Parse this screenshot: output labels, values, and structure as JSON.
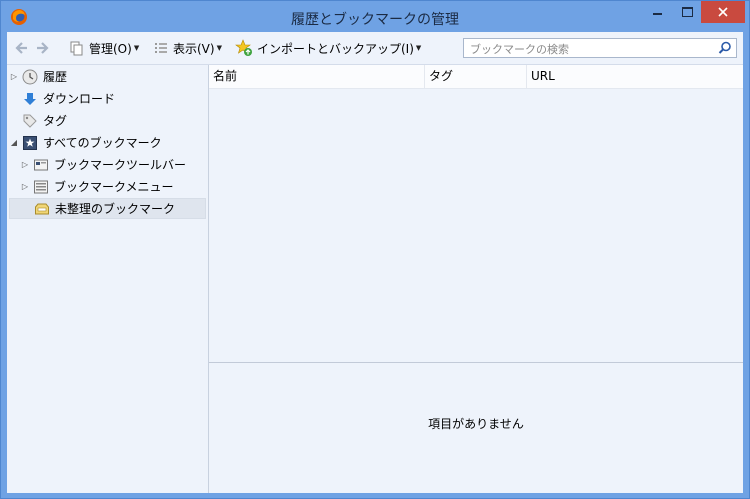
{
  "window": {
    "title": "履歴とブックマークの管理",
    "app_icon": "firefox-icon",
    "close_color": "#c94a3f",
    "titlebar_color": "#6fa2e4"
  },
  "toolbar": {
    "back_icon": "back-arrow-icon",
    "forward_icon": "forward-arrow-icon",
    "organize_label": "管理(O)",
    "views_label": "表示(V)",
    "import_label": "インポートとバックアップ(I)",
    "search_placeholder": "ブックマークの検索",
    "search_value": ""
  },
  "sidebar": {
    "items": [
      {
        "label": "履歴",
        "icon": "clock-icon"
      },
      {
        "label": "ダウンロード",
        "icon": "download-arrow-icon"
      },
      {
        "label": "タグ",
        "icon": "tag-icon"
      },
      {
        "label": "すべてのブックマーク",
        "icon": "bookmarks-icon"
      },
      {
        "label": "ブックマークツールバー",
        "icon": "toolbar-folder-icon"
      },
      {
        "label": "ブックマークメニュー",
        "icon": "menu-folder-icon"
      },
      {
        "label": "未整理のブックマーク",
        "icon": "unsorted-folder-icon"
      }
    ]
  },
  "table": {
    "columns": [
      "名前",
      "タグ",
      "URL"
    ],
    "rows": []
  },
  "detail": {
    "empty_message": "項目がありません"
  }
}
